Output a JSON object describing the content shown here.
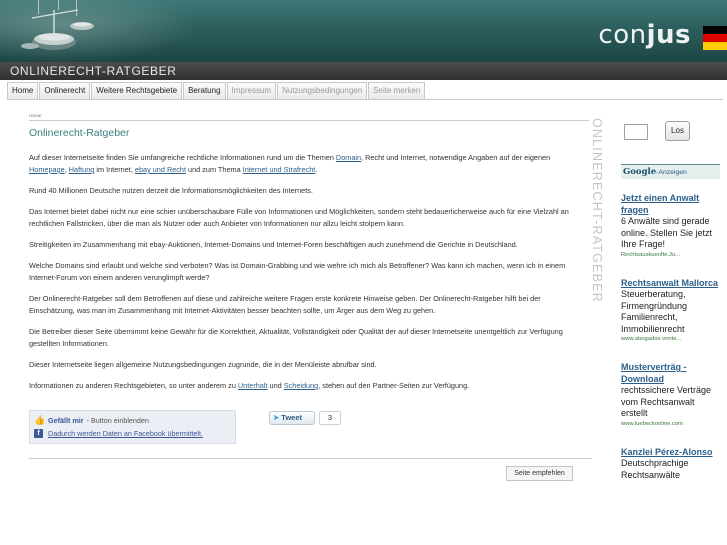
{
  "header": {
    "logo_light": "con",
    "logo_bold": "jus",
    "site_title": "ONLINERECHT-RATGEBER",
    "flag_colors": [
      "#000000",
      "#dd0000",
      "#ffce00"
    ]
  },
  "nav": {
    "items": [
      {
        "label": "Home",
        "enabled": true
      },
      {
        "label": "Onlinerecht",
        "enabled": true
      },
      {
        "label": "Weitere Rechtsgebiete",
        "enabled": true
      },
      {
        "label": "Beratung",
        "enabled": true
      },
      {
        "label": "Impressum",
        "enabled": false
      },
      {
        "label": "Nutzungsbedingungen",
        "enabled": false
      },
      {
        "label": "Seite merken",
        "enabled": false
      }
    ]
  },
  "main": {
    "breadcrumb": "HOME",
    "title": "Onlinerecht-Ratgeber",
    "vertical_label": "ONLINERECHT-RATGEBER",
    "p1": {
      "t1": "Auf dieser Internetseite finden Sie umfangreiche rechtliche Informationen rund um die Themen ",
      "l1": "Domain",
      "t2": ", Recht und Internet, notwendige Angaben auf der eigenen ",
      "l2": "Homepage",
      "t3": ", ",
      "l3": "Haftung",
      "t4": " im Internet, ",
      "l4": "ebay und Recht",
      "t5": " und zum Thema ",
      "l5": "Internet und Strafrecht",
      "t6": "."
    },
    "p2": "Rund 40 Millionen Deutsche nutzen derzeit die Informationsmöglichkeiten des Internets.",
    "p3": "Das Internet bietet dabei nicht nur eine schier unüberschaubare Fülle von Informationen und Möglichkeiten, sondern steht bedauerlicherweise auch für eine Vielzahl an rechtlichen Fallstricken, über die man als Nutzer oder auch Anbieter von Informationen nur allzu leicht stolpern kann.",
    "p4": "Streitigkeiten im Zusammenhang mit ebay-Auktionen, Internet-Domains und Internet-Foren beschäftigen auch zunehmend die Gerichte in Deutschland.",
    "p5": "Welche Domains sind erlaubt und welche sind verboten? Was ist Domain-Grabbing und wie wehre ich mich als Betroffener? Was kann ich machen, wenn ich in einem Internet-Forum von einem anderen verunglimpft werde?",
    "p6": "Der Onlinerecht-Ratgeber soll dem Betroffenen auf diese und zahlreiche weitere Fragen erste konkrete Hinweise geben. Der Onlinerecht-Ratgeber hilft bei der Einschätzung, was man im Zusammenhang mit Internet-Aktivitäten besser beachten sollte, um Ärger aus dem Weg zu gehen.",
    "p7": "Die Betreiber dieser Seite übernimmt keine Gewähr für die Korrektheit, Aktualität, Vollständigkeit oder Qualität der auf dieser Internetseite unentgeltlich zur Verfügung gestellten Informationen.",
    "p8": "Dieser Internetseite liegen allgemeine Nutzungsbedingungen zugrunde, die in der Menüleiste abrufbar sind.",
    "p9": {
      "t1": "Informationen zu anderen Rechtsgebieten, so unter anderem zu ",
      "l1": "Unterhalt",
      "t2": " und ",
      "l2": "Scheidung",
      "t3": ", stehen auf den Partner-Seiten zur Verfügung."
    },
    "facebook": {
      "like_label": "Gefällt mir",
      "note": " - Button einblenden",
      "privacy_link": "Dadurch werden Daten an Facebook übermittelt."
    },
    "tweet": {
      "label": "Tweet",
      "count": "3"
    },
    "bookmark_button": "Seite empfehlen"
  },
  "sidebar": {
    "search_value": "",
    "search_button": "Los",
    "ads_brand": "Google",
    "ads_label": "-Anzeigen",
    "ads": [
      {
        "title": "Jetzt einen Anwalt fragen",
        "body": "6 Anwälte sind gerade online. Stellen Sie jetzt Ihre Frage!",
        "url": "Rechtsauskuenfte.Ju..."
      },
      {
        "title": "Rechtsanwalt Mallorca",
        "body": "Steuerberatung, Firmengründung Familienrecht, Immobilienrecht",
        "url": "www.abogados-vonte..."
      },
      {
        "title": "Musterverträg - Download",
        "body": "rechtssichere Verträge vom Rechtsanwalt erstellt",
        "url": "www.luebeckonline.com"
      },
      {
        "title": "Kanzlei Pérez-Alonso",
        "body": "Deutschprachige Rechtsanwälte",
        "url": ""
      }
    ]
  }
}
